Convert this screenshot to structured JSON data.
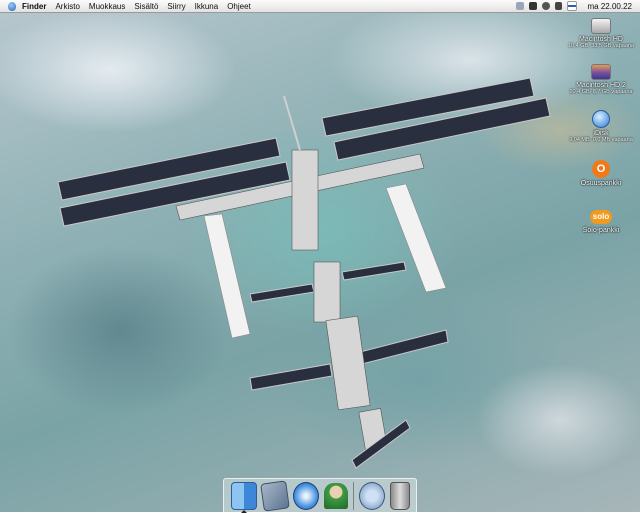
{
  "menubar": {
    "apple_icon": "apple-icon",
    "items": [
      "Finder",
      "Arkisto",
      "Muokkaus",
      "Sisältö",
      "Siirry",
      "Ikkuna",
      "Ohjeet"
    ],
    "clock": "ma 22.00.22"
  },
  "desktop_icons": [
    {
      "name": "Macintosh HD",
      "sub": "10,4 GB, 33,5 GB vapaana",
      "icon": "hard-disk-icon"
    },
    {
      "name": "Macintosh HD 2",
      "sub": "20,4 GB, 8,7 GB vapaana",
      "icon": "hard-disk-icon"
    },
    {
      "name": "iDisk",
      "sub": "9,04 MB, 0,0 MB vapaana",
      "icon": "idisk-icon"
    },
    {
      "name": "Osuuspankki",
      "sub": "",
      "icon": "osuuspankki-icon",
      "glyph": "O"
    },
    {
      "name": "Solo-pankki",
      "sub": "",
      "icon": "solo-icon",
      "glyph": "solo"
    }
  ],
  "dock": {
    "items": [
      "Finder",
      "Mail",
      "Safari",
      "iChat",
      "System Preferences",
      "Trash"
    ]
  },
  "colors": {
    "menubar_bg": "#e9e9e9",
    "finder_blue": "#3e86d8",
    "osuuspankki_orange": "#f07a1a",
    "solo_orange": "#f39a1e"
  }
}
